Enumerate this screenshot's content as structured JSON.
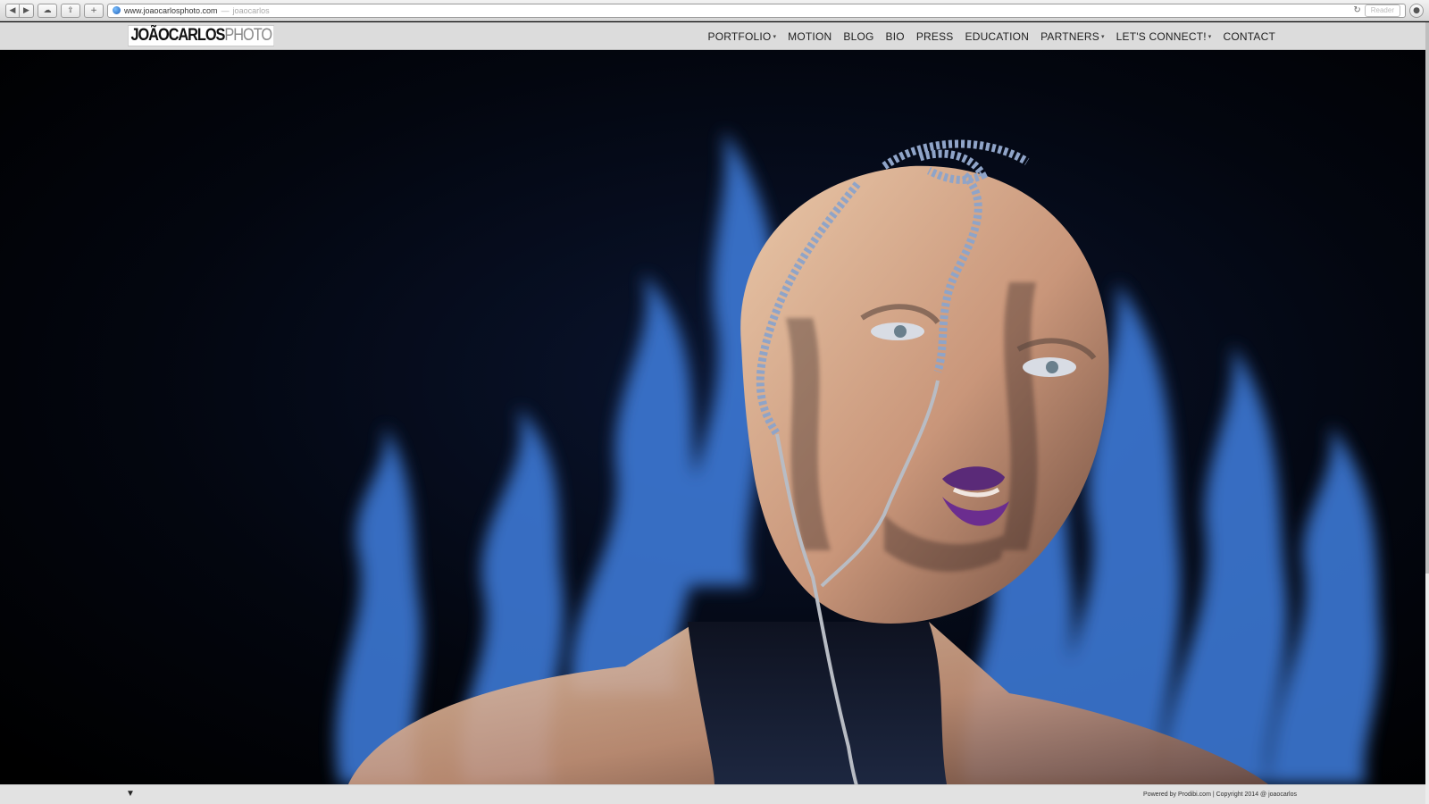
{
  "browser": {
    "url": "www.joaocarlosphoto.com",
    "page_title": "joaocarlos",
    "url_sep": "—",
    "reader_label": "Reader"
  },
  "site": {
    "logo_primary": "JOÃOCARLOS",
    "logo_secondary": "PHOTO"
  },
  "nav": [
    {
      "label": "PORTFOLIO",
      "dropdown": true
    },
    {
      "label": "MOTION",
      "dropdown": false
    },
    {
      "label": "BLOG",
      "dropdown": false
    },
    {
      "label": "BIO",
      "dropdown": false
    },
    {
      "label": "PRESS",
      "dropdown": false
    },
    {
      "label": "EDUCATION",
      "dropdown": false
    },
    {
      "label": "PARTNERS",
      "dropdown": true
    },
    {
      "label": "LET'S CONNECT!",
      "dropdown": true
    },
    {
      "label": "CONTACT",
      "dropdown": false
    }
  ],
  "icons": {
    "caret": "▾",
    "down_arrow": "▼"
  },
  "footer": {
    "copyright": "Powered by Prodibi.com | Copyright 2014 @ joaocarlos"
  },
  "colors": {
    "flame_blue": "#3f7fe0",
    "background": "#000000",
    "header_bg": "#dcdcdc"
  }
}
